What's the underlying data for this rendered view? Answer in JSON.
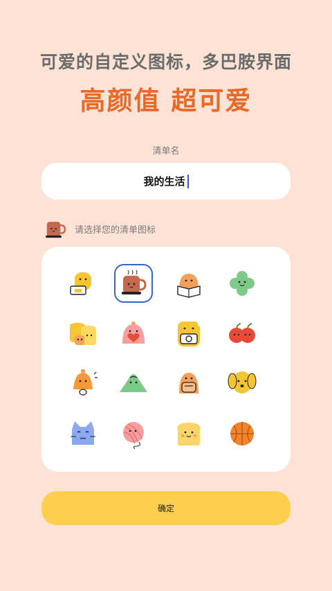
{
  "headline": "可爱的自定义图标，多巴胺界面",
  "big_title": "高颜值 超可爱",
  "name_field": {
    "label": "清单名",
    "value": "我的生活"
  },
  "icon_picker": {
    "hint": "请选择您的清单图标",
    "selected_icon": "coffee-mug-icon",
    "icons": [
      "yellow-blob-laptop-icon",
      "coffee-mug-icon",
      "orange-bun-reading-icon",
      "green-clover-icon",
      "yellow-cups-icon",
      "pink-bun-heart-icon",
      "yellow-camera-icon",
      "red-apples-icon",
      "orange-bell-icon",
      "green-mountain-icon",
      "orange-backpack-icon",
      "yellow-dog-icon",
      "blue-cat-icon",
      "pink-yarn-ball-icon",
      "toast-bread-icon",
      "basketball-icon"
    ]
  },
  "confirm_button": {
    "label": "确定"
  },
  "colors": {
    "background": "#fde3d6",
    "accent_title": "#e8692a",
    "button": "#fccf4e",
    "selection_border": "#2f66c8"
  }
}
